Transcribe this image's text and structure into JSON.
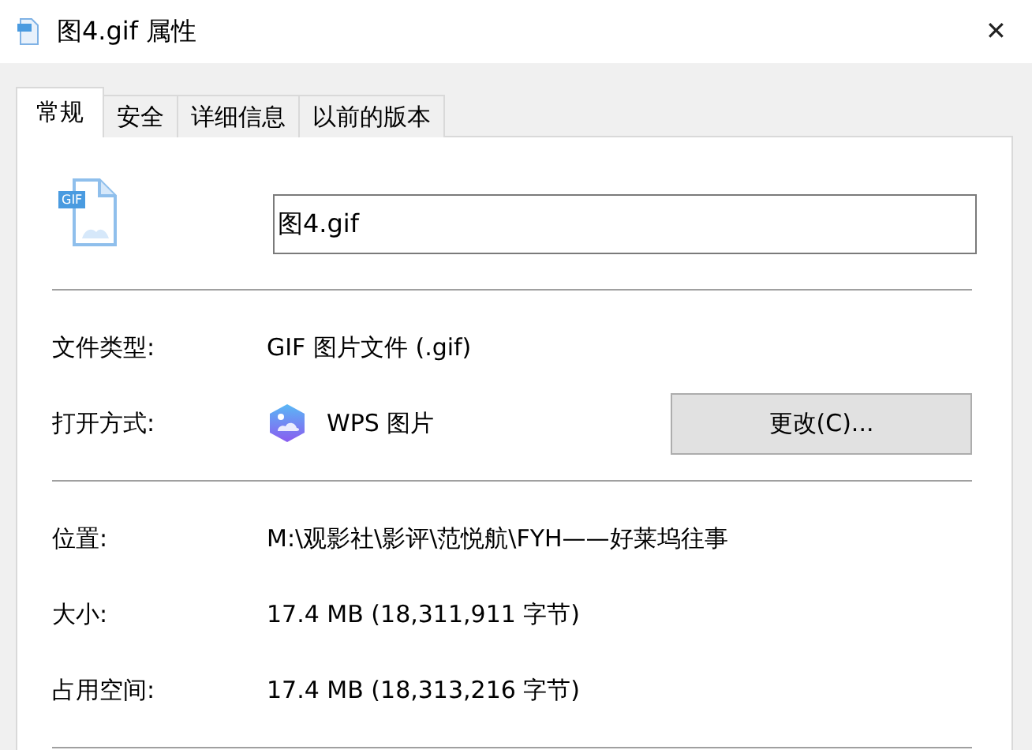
{
  "window": {
    "title": "图4.gif 属性",
    "close": "✕"
  },
  "tabs": [
    {
      "label": "常规",
      "selected": true
    },
    {
      "label": "安全",
      "selected": false
    },
    {
      "label": "详细信息",
      "selected": false
    },
    {
      "label": "以前的版本",
      "selected": false
    }
  ],
  "file": {
    "icon_label": "GIF",
    "name": "图4.gif"
  },
  "sections": [
    [
      {
        "kind": "text",
        "label": "文件类型:",
        "value": "GIF 图片文件 (.gif)"
      },
      {
        "kind": "app",
        "label": "打开方式:",
        "value": "WPS 图片",
        "button": "更改(C)..."
      }
    ],
    [
      {
        "kind": "text",
        "label": "位置:",
        "value": "M:\\观影社\\影评\\范悦航\\FYH——好莱坞往事"
      },
      {
        "kind": "text",
        "label": "大小:",
        "value": "17.4 MB (18,311,911 字节)"
      },
      {
        "kind": "text",
        "label": "占用空间:",
        "value": "17.4 MB (18,313,216 字节)"
      }
    ]
  ]
}
